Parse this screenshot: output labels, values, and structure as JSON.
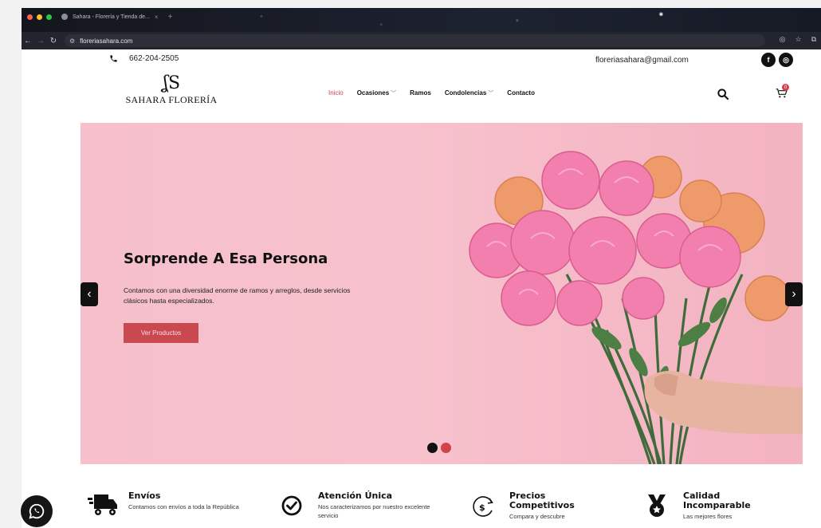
{
  "browser": {
    "tab_title": "Sahara - Florería y Tienda de...",
    "tab_close": "×",
    "new_tab": "+",
    "url": "floreriasahara.com"
  },
  "topbar": {
    "phone": "662-204-2505",
    "email": "floreriasahara@gmail.com"
  },
  "header": {
    "logo_monogram": "ʆS",
    "logo_name": "SAHARA FLORERÍA",
    "menu": [
      {
        "label": "Inicio",
        "active": true,
        "dropdown": false
      },
      {
        "label": "Ocasiones",
        "active": false,
        "dropdown": true
      },
      {
        "label": "Ramos",
        "active": false,
        "dropdown": false
      },
      {
        "label": "Condolencias",
        "active": false,
        "dropdown": true
      },
      {
        "label": "Contacto",
        "active": false,
        "dropdown": false
      }
    ],
    "cart_count": "0"
  },
  "hero": {
    "title": "Sorprende A Esa Persona",
    "text": "Contamos con una diversidad enorme de ramos y arreglos, desde servicios clásicos hasta especializados.",
    "button": "Ver Productos",
    "prev_arrow": "‹",
    "next_arrow": "›",
    "slide_active_index": 1,
    "slide_count": 2
  },
  "features": [
    {
      "icon": "delivery-truck-icon",
      "title": "Envíos",
      "desc": "Contamos con envíos a toda la República"
    },
    {
      "icon": "check-circle-icon",
      "title": "Atención Única",
      "desc": "Nos caracterizamos por nuestro excelente servicio"
    },
    {
      "icon": "price-dollar-icon",
      "title": "Precios Competitivos",
      "desc": "Compara y descubre"
    },
    {
      "icon": "medal-icon",
      "title": "Calidad Incomparable",
      "desc": "Las mejores flores"
    }
  ],
  "colors": {
    "accent": "#c9494f",
    "hero_bg": "#f6bfcb",
    "dark": "#111111"
  }
}
